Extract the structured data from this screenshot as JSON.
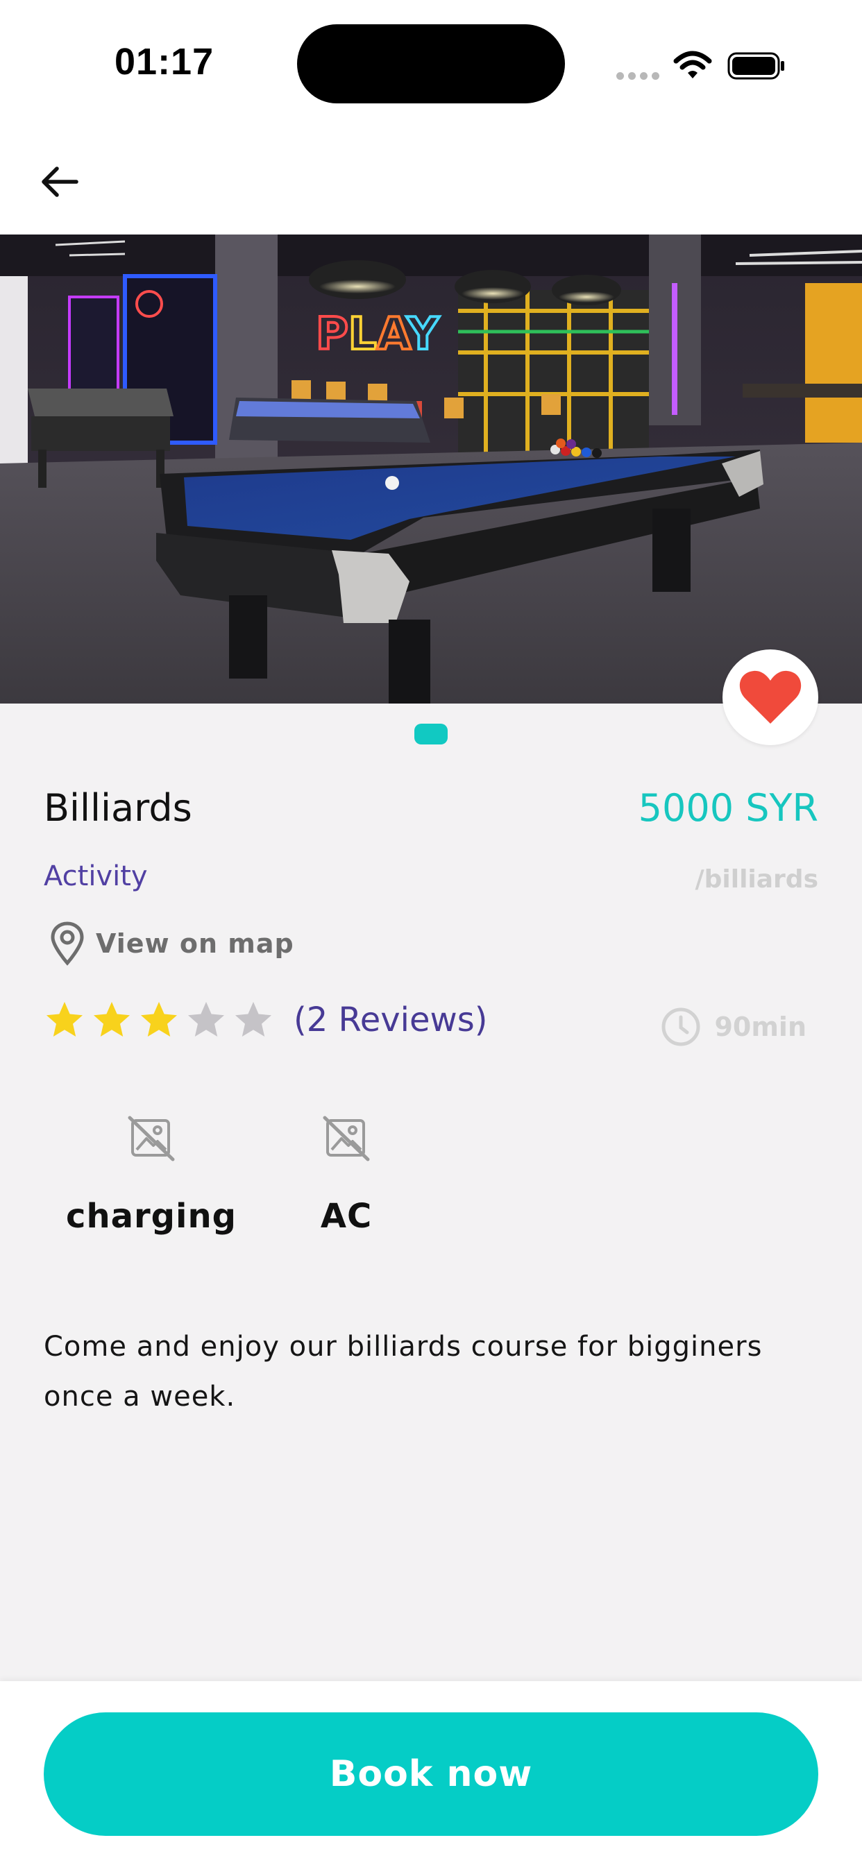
{
  "status_bar": {
    "time": "01:17"
  },
  "activity": {
    "title": "Billiards",
    "price": "5000 SYR",
    "category": "Activity",
    "unit": "/billiards",
    "map_link": "View on map",
    "rating": 3,
    "rating_max": 5,
    "reviews": "(2 Reviews)",
    "duration": "90min",
    "image_count": 1,
    "current_image": 1,
    "favorite": true
  },
  "amenities": [
    {
      "icon": "image-off-icon",
      "name": "charging"
    },
    {
      "icon": "image-off-icon",
      "name": "AC"
    }
  ],
  "description": "Come and enjoy our billiards course for bigginers once a week.",
  "cta": {
    "label": "Book now"
  },
  "colors": {
    "accent": "#05cdc6",
    "price": "#17c6bf",
    "category": "#5140a3",
    "star_filled": "#f8d21c",
    "star_empty": "#c5c3c7",
    "favorite": "#f04a3b"
  }
}
